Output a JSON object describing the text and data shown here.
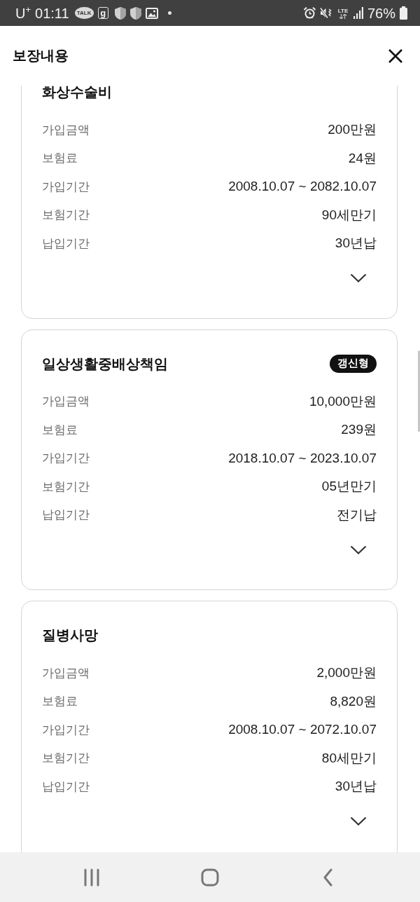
{
  "status_bar": {
    "carrier": "U$^{+}$",
    "time": "01:11",
    "notifications": [
      {
        "kind": "talk",
        "label": "TALK"
      },
      {
        "kind": "letter",
        "label": "g"
      },
      {
        "kind": "shield"
      },
      {
        "kind": "shield"
      },
      {
        "kind": "image"
      },
      {
        "kind": "dot"
      }
    ],
    "indicators": [
      {
        "kind": "alarm"
      },
      {
        "kind": "mute"
      },
      {
        "kind": "network",
        "label": "LTE"
      },
      {
        "kind": "signal"
      }
    ],
    "battery": "76%"
  },
  "header": {
    "title": "보장내용"
  },
  "coverages": [
    {
      "title": "화상수술비",
      "expanded": false,
      "rows": [
        {
          "label": "가입금액",
          "value": "200만원"
        },
        {
          "label": "보험료",
          "value": "24원"
        },
        {
          "label": "가입기간",
          "value": "2008.10.07 ~ 2082.10.07"
        },
        {
          "label": "보험기간",
          "value": "90세만기"
        },
        {
          "label": "납입기간",
          "value": "30년납"
        }
      ]
    },
    {
      "title": "일상생활중배상책임",
      "badge": "갱신형",
      "expanded": false,
      "rows": [
        {
          "label": "가입금액",
          "value": "10,000만원"
        },
        {
          "label": "보험료",
          "value": "239원"
        },
        {
          "label": "가입기간",
          "value": "2018.10.07 ~ 2023.10.07"
        },
        {
          "label": "보험기간",
          "value": "05년만기"
        },
        {
          "label": "납입기간",
          "value": "전기납"
        }
      ]
    },
    {
      "title": "질병사망",
      "expanded": false,
      "rows": [
        {
          "label": "가입금액",
          "value": "2,000만원"
        },
        {
          "label": "보험료",
          "value": "8,820원"
        },
        {
          "label": "가입기간",
          "value": "2008.10.07 ~ 2072.10.07"
        },
        {
          "label": "보험기간",
          "value": "80세만기"
        },
        {
          "label": "납입기간",
          "value": "30년납"
        }
      ]
    }
  ],
  "nav_bar": {
    "buttons": [
      {
        "kind": "recent"
      },
      {
        "kind": "home"
      },
      {
        "kind": "back"
      }
    ]
  }
}
